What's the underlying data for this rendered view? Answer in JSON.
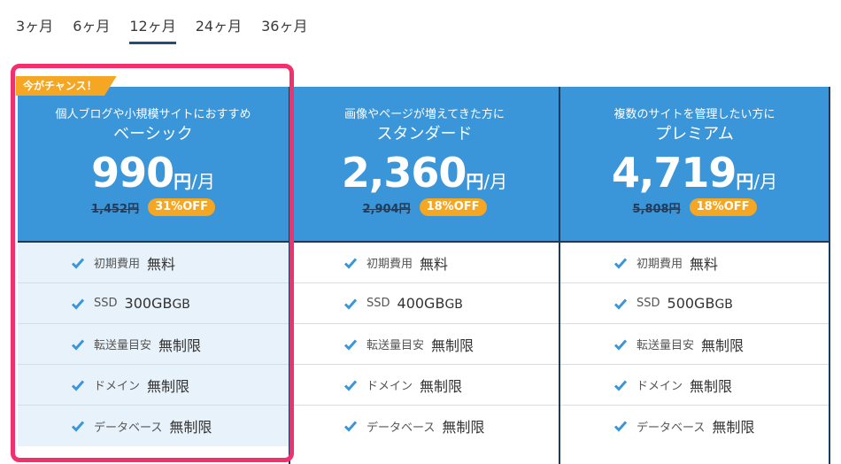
{
  "tabs": [
    {
      "label": "3ヶ月",
      "active": false
    },
    {
      "label": "6ヶ月",
      "active": false
    },
    {
      "label": "12ヶ月",
      "active": true
    },
    {
      "label": "24ヶ月",
      "active": false
    },
    {
      "label": "36ヶ月",
      "active": false
    }
  ],
  "badge": "今がチャンス！",
  "plans": [
    {
      "subtitle": "個人ブログや小規模サイトにおすすめ",
      "name": "ベーシック",
      "price": "990",
      "unit": "円",
      "per": "/月",
      "old_price": "1,452円",
      "discount": "31%OFF",
      "features": [
        {
          "label": "初期費用",
          "value": "無料"
        },
        {
          "label": "SSD",
          "value": "300GB",
          "suffix": "GB"
        },
        {
          "label": "転送量目安",
          "value": "無制限"
        },
        {
          "label": "ドメイン",
          "value": "無制限"
        },
        {
          "label": "データベース",
          "value": "無制限"
        }
      ]
    },
    {
      "subtitle": "画像やページが増えてきた方に",
      "name": "スタンダード",
      "price": "2,360",
      "unit": "円",
      "per": "/月",
      "old_price": "2,904円",
      "discount": "18%OFF",
      "features": [
        {
          "label": "初期費用",
          "value": "無料"
        },
        {
          "label": "SSD",
          "value": "400GB",
          "suffix": "GB"
        },
        {
          "label": "転送量目安",
          "value": "無制限"
        },
        {
          "label": "ドメイン",
          "value": "無制限"
        },
        {
          "label": "データベース",
          "value": "無制限"
        }
      ]
    },
    {
      "subtitle": "複数のサイトを管理したい方に",
      "name": "プレミアム",
      "price": "4,719",
      "unit": "円",
      "per": "/月",
      "old_price": "5,808円",
      "discount": "18%OFF",
      "features": [
        {
          "label": "初期費用",
          "value": "無料"
        },
        {
          "label": "SSD",
          "value": "500GB",
          "suffix": "GB"
        },
        {
          "label": "転送量目安",
          "value": "無制限"
        },
        {
          "label": "ドメイン",
          "value": "無制限"
        },
        {
          "label": "データベース",
          "value": "無制限"
        }
      ]
    }
  ],
  "colors": {
    "header_bg": "#3a96d9",
    "accent_orange": "#f5a623",
    "highlight_border": "#f0316d",
    "check": "#3a96d9"
  },
  "icons": {
    "check": "check-icon"
  }
}
